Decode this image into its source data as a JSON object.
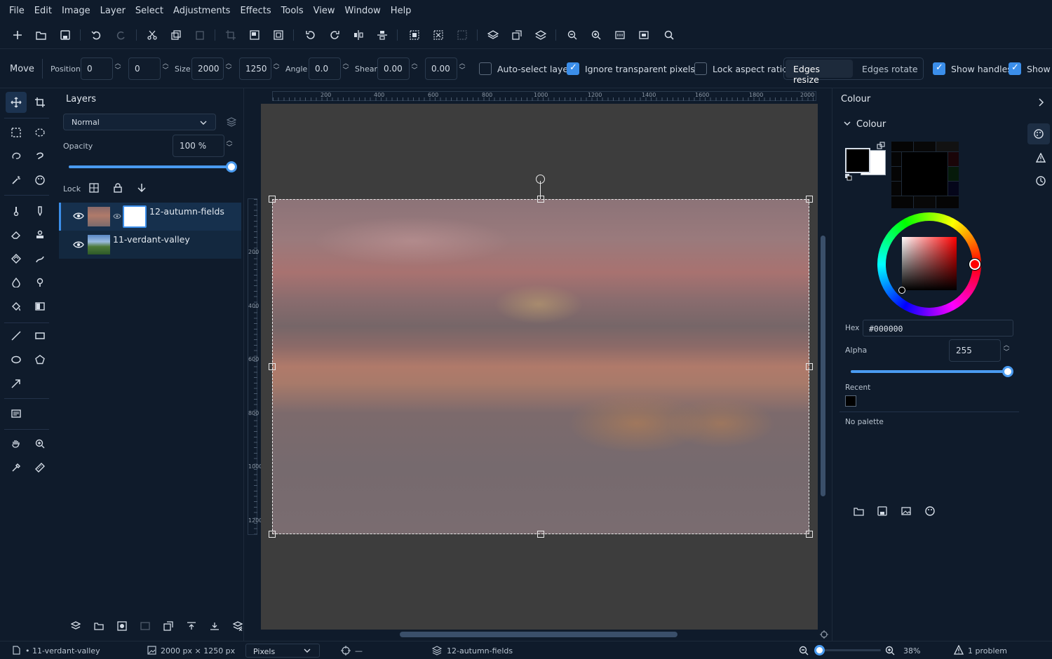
{
  "menu": [
    "File",
    "Edit",
    "Image",
    "Layer",
    "Select",
    "Adjustments",
    "Effects",
    "Tools",
    "View",
    "Window",
    "Help"
  ],
  "options": {
    "tool_name": "Move",
    "position_label": "Position",
    "position_x": "0",
    "position_y": "0",
    "size_label": "Size",
    "size_w": "2000",
    "size_h": "1250",
    "angle_label": "Angle",
    "angle": "0.0",
    "shear_label": "Shear",
    "shear_x": "0.00",
    "shear_y": "0.00",
    "auto_select_label": "Auto-select layer",
    "auto_select_checked": false,
    "ignore_transparent_label": "Ignore transparent pixels",
    "ignore_transparent_checked": true,
    "lock_aspect_label": "Lock aspect ratio",
    "lock_aspect_checked": false,
    "edges_resize_label": "Edges resize",
    "edges_rotate_label": "Edges rotate",
    "show_handles_label": "Show handles",
    "show_handles_checked": true,
    "show_extra_label": "Show",
    "show_extra_checked": true
  },
  "layers_panel": {
    "title": "Layers",
    "blend_mode": "Normal",
    "opacity_label": "Opacity",
    "opacity_value": "100 %",
    "opacity_fraction": 1.0,
    "lock_label": "Lock",
    "layers": [
      {
        "name": "12-autumn-fields",
        "visible": true,
        "selected": true,
        "has_mask": true
      },
      {
        "name": "11-verdant-valley",
        "visible": true,
        "selected": false,
        "has_mask": false
      }
    ]
  },
  "rulers": {
    "horizontal": [
      "200",
      "400",
      "600",
      "800",
      "1000",
      "1200",
      "1400",
      "1600",
      "1800",
      "2000"
    ],
    "vertical": [
      "200",
      "400",
      "600",
      "800",
      "1000",
      "1200"
    ]
  },
  "colour_panel": {
    "title": "Colour",
    "section": "Colour",
    "primary_color": "#000000",
    "secondary_color": "#ffffff",
    "hex_label": "Hex",
    "hex_value": "#000000",
    "alpha_label": "Alpha",
    "alpha_value": "255",
    "alpha_fraction": 1.0,
    "recent_label": "Recent",
    "recent_colors": [
      "#000000"
    ],
    "palette_text": "No palette"
  },
  "status": {
    "layer": "• 11-verdant-valley",
    "dimensions": "2000 px × 1250 px",
    "units": "Pixels",
    "cursor": "—",
    "active_layer": "12-autumn-fields",
    "zoom": "38%",
    "problems": "1 problem"
  },
  "colors": {
    "accent": "#3b8eea",
    "background": "#0f1b2b",
    "canvas_bg": "#3d3d3d"
  }
}
